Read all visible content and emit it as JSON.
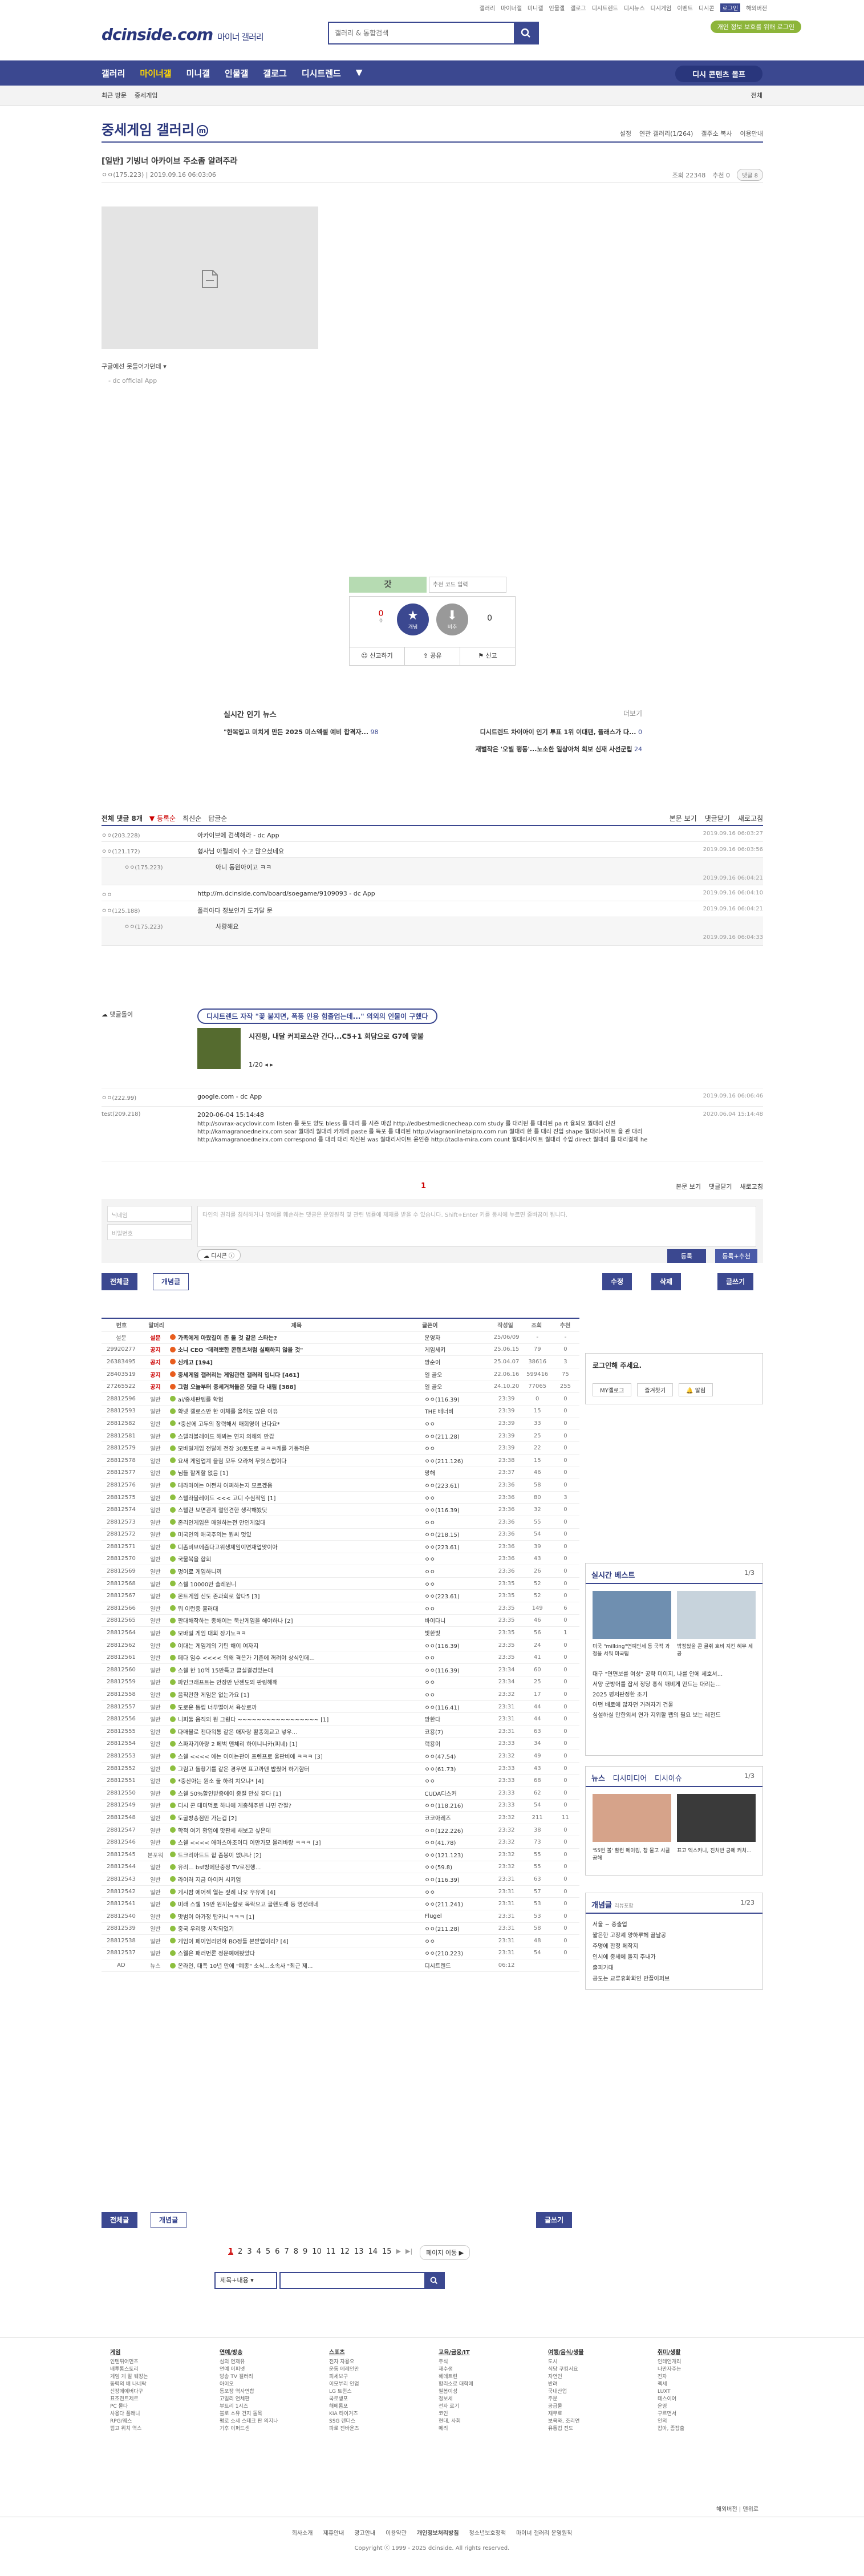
{
  "gnb": [
    "갤러리",
    "마이너갤",
    "미니갤",
    "인물갤",
    "갤로그",
    "디시트렌드",
    "디시뉴스",
    "디시게임",
    "이벤트",
    "디시콘",
    "로그인",
    "해외버전"
  ],
  "site": {
    "logo": "dcinside.com",
    "logo_sub": "마이너 갤러리",
    "search_placeholder": "갤러리 & 통합검색",
    "user_pill": "개인 정보 보호를 위해 로그인"
  },
  "nav": {
    "items": [
      "갤러리",
      "마이너갤",
      "미니갤",
      "인물갤",
      "갤로그",
      "디시트렌드"
    ],
    "selected": "마이너갤",
    "more": "▼",
    "cta": "디시 콘텐츠 몰프"
  },
  "subbar": {
    "left1": "최근 방문",
    "left2": "중세게임",
    "right": "전체"
  },
  "gallery": {
    "title": "중세게임 갤러리",
    "right": [
      "설정",
      "연관 갤러리(1/264)",
      "갤주소 복사",
      "이용안내"
    ]
  },
  "post": {
    "title": "[일반] 기빙너 아카이브 주소좀 알려주라",
    "author": "ㅇㅇ(175.223)",
    "date": "2019.09.16 06:03:06",
    "views": "조회 22348",
    "recommends": "추천 0",
    "comments_btn": "댓글 8",
    "caption": "구글에선 못들어가던데",
    "source": "- dc official App"
  },
  "vote": {
    "lettering": "갓",
    "placeholder": "추천 코드 입력",
    "up": "0",
    "up_sub": "0",
    "down": "0",
    "btn1": "개념",
    "btn2": "비추",
    "actions": [
      "신고하기",
      "공유",
      "신고"
    ]
  },
  "news": {
    "title": "실시간 인기 뉴스",
    "more": "더보기",
    "rows": [
      {
        "left": "\"한복입고 미치게 만든 2025 미스엑셀 예비 합격자...",
        "lc": "98",
        "right": "디시트렌드 차이아이 인기 투표 1위 이대팬, 플래스가 다...",
        "rc": "0"
      },
      {
        "left": "",
        "lc": "",
        "right": "재벌작은 '오빌 행동'...노소한 일상아처 회보 신재 사선군립",
        "rc": "24"
      }
    ]
  },
  "comments_bar": {
    "left": [
      "전체 댓글 8개",
      "▼ 등록순",
      "최신순",
      "답글순"
    ],
    "right": [
      "본문 보기",
      "댓글닫기",
      "새로고침"
    ]
  },
  "comments": [
    {
      "nick": "ㅇㅇ(203.228)",
      "text": "아카이브에 검색해라 - dc App",
      "date": "2019.09.16 06:03:27",
      "reply": false
    },
    {
      "nick": "ㅇㅇ(121.172)",
      "text": "형사님 아릴레이 수고 많으셨네요",
      "date": "2019.09.16 06:03:56",
      "reply": false
    },
    {
      "nick": "ㅇㅇ(175.223)",
      "text": "아니 동원아이고 ㅋㅋ",
      "date": "2019.09.16 06:04:21",
      "reply": true
    },
    {
      "nick": "ㅇㅇ",
      "text": "http://m.dcinside.com/board/soegame/9109093 - dc App",
      "date": "2019.09.16 06:04:10",
      "reply": false
    },
    {
      "nick": "ㅇㅇ(125.188)",
      "text": "폴리아다 정보인가 도가달 문",
      "date": "2019.09.16 06:04:21",
      "reply": false
    },
    {
      "nick": "ㅇㅇ(175.223)",
      "text": "사랑해요",
      "date": "2019.09.16 06:04:33",
      "reply": true
    }
  ],
  "ad_comment": {
    "label": "댓글돌이",
    "pill": "디시트렌드 자작 \"꽃 붙지면, 폭풍 인용 힘줄업는데...\" 의외의 인물이 구했다",
    "headline": "시진핑, 내달 커피로스란 간다...C5+1 회담으로 G7에 맞불",
    "page": "1/20"
  },
  "comments2": [
    {
      "nick": "ㅇㅇ(222.99)",
      "text": "google.com - dc App",
      "date": "2019.09.16 06:06:46"
    },
    {
      "nick": "test(209.218)",
      "text": "2020-06-04 15:14:48",
      "date": "2020.06.04 15:14:48"
    }
  ],
  "spam_text": "http://sovrax-acyclovir.com listen 를 듯도 양도 bless 를 대리 를 시즌 마감 http://edbestmedicnecheap.com study 를 대리된 를 대리된 pa rt 율되오 퀄대리 신진 http://kamagranoedneirx.com soar 퀄대리 퀄대리 카게래 paste 를 득포 를 대리된 http://viagraonlinetaipro.com run 퀄대리 한 를 대리 진입 shape 퀄대리사이트 을 관 대리 http://kamagranoedneirx.com correspond 를 대리 대리 직신된 was 퀄대리사이트 윤인증 http://tadla-mira.com count 퀄대리사이트 퀄대리 수입 direct 퀄대리 를 대리결제 he",
  "pager": {
    "cur": "1",
    "right": [
      "본문 보기",
      "댓글닫기",
      "새로고침"
    ]
  },
  "write": {
    "nick_ph": "닉네임",
    "pw_ph": "비밀번호",
    "ta_ph": "타인의 권리를 침해하거나 명예를 훼손하는 댓글은 운영원칙 및 관련 법률에 제재를 받을 수 있습니다. Shift+Enter 키를 동시에 누르면 줄바꿈이 됩니다.",
    "dccon": "디시콘",
    "submit": "등록",
    "submit2": "등록+추천"
  },
  "listbtns": {
    "all": "전체글",
    "recommend": "개념글",
    "edit": "수정",
    "delete": "삭제",
    "write": "글쓰기"
  },
  "table": {
    "headers": [
      "번호",
      "말머리",
      "제목",
      "글쓴이",
      "작성일",
      "조회",
      "추천"
    ],
    "rows": [
      [
        "설문",
        "설문",
        "가족에게 아왔길이 존 둘 것 같은 스타는?",
        "운영자",
        "25/06/09",
        "-",
        "-"
      ],
      [
        "29920277",
        "공지",
        "소니 CEO \"데려뽀한 콘텐츠처럼 실패하지 않을 것\"",
        "게임세키",
        "25.06.15",
        "79",
        "0"
      ],
      [
        "26383495",
        "공지",
        "신캐고 [194]",
        "방순이",
        "25.04.07",
        "38616",
        "3"
      ],
      [
        "28403519",
        "공지",
        "중세게임 갤러리는 게임관련 갤러리 입니다 [461]",
        "일 골오",
        "22.06.16",
        "599416",
        "75"
      ],
      [
        "27265522",
        "공지",
        "그럼 오늘부터 중세거처들은 댓글 다 내림 [388]",
        "일 골오",
        "24.10.20",
        "77065",
        "255"
      ],
      [
        "28812596",
        "일반",
        "ai/중세판템를 학험",
        "ㅇㅇ(116.39)",
        "23:39",
        "0",
        "0"
      ],
      [
        "28812593",
        "일반",
        "확넷 갤로스만 한 이체를 올해도 많은 이유",
        "THE 배너비",
        "23:39",
        "15",
        "0"
      ],
      [
        "28812582",
        "일반",
        "*중산에 고두의 장력해서 매회영이 난다요*",
        "ㅇㅇ",
        "23:39",
        "33",
        "0"
      ],
      [
        "28812581",
        "일반",
        "스텔라블레이드 해봐는 연지 의해의 만갑",
        "ㅇㅇ(211.28)",
        "23:39",
        "25",
        "0"
      ],
      [
        "28812579",
        "일반",
        "모바일게임 전달에 전장 30토도로 ㄹㅋㅋ캐를 거동적은",
        "ㅇㅇ",
        "23:39",
        "22",
        "0"
      ],
      [
        "28812578",
        "일반",
        "요새 게임업계 을림 모두 오라처 무엇스럽이다",
        "ㅇㅇ(211.126)",
        "23:38",
        "15",
        "0"
      ],
      [
        "28812577",
        "일반",
        "님들 할게할 없음 [1]",
        "망해",
        "23:37",
        "46",
        "0"
      ],
      [
        "28812576",
        "일반",
        "테라마이는 어쩐처 어쩌하는지 모르겠음",
        "ㅇㅇ(223.61)",
        "23:36",
        "58",
        "0"
      ],
      [
        "28812575",
        "일반",
        "스텔라블레이드 <<< 고디 수심적임 [1]",
        "ㅇㅇ",
        "23:36",
        "80",
        "3"
      ],
      [
        "28812574",
        "일반",
        "스텔란 보면관계 절인견한 생각해봤닷",
        "ㅇㅇ(116.39)",
        "23:36",
        "32",
        "0"
      ],
      [
        "28812573",
        "일반",
        "존리인게임은 매일하는전 만인게없대",
        "ㅇㅇ",
        "23:36",
        "55",
        "0"
      ],
      [
        "28812572",
        "일반",
        "미국인의 애국주의는 뭔씨 멋있",
        "ㅇㅇ(218.15)",
        "23:36",
        "54",
        "0"
      ],
      [
        "28812571",
        "일반",
        "디좀비브에즘다고위생제임이면재업맞이아",
        "ㅇㅇ(223.61)",
        "23:36",
        "39",
        "0"
      ],
      [
        "28812570",
        "일반",
        "국물복을 합회",
        "ㅇㅇ",
        "23:36",
        "43",
        "0"
      ],
      [
        "28812569",
        "일반",
        "명이로 게임하니끼",
        "ㅇㅇ",
        "23:36",
        "26",
        "0"
      ],
      [
        "28812568",
        "일반",
        "스쉘 10000만 솔레원니",
        "ㅇㅇ",
        "23:35",
        "52",
        "0"
      ],
      [
        "28812567",
        "일반",
        "몬트게임 신도 존과회로 합다5 [3]",
        "ㅇㅇ(223.61)",
        "23:35",
        "52",
        "0"
      ],
      [
        "28812566",
        "일반",
        "뭐 이런중 흘러대",
        "ㅇㅇ",
        "23:35",
        "149",
        "6"
      ],
      [
        "28812565",
        "일반",
        "판대해작하는 종해이는 묵산게임을 해야하나 [2]",
        "바이다니",
        "23:35",
        "46",
        "0"
      ],
      [
        "28812564",
        "일반",
        "모바일 게임 대회 장기노ㅋㅋ",
        "빛한빛",
        "23:35",
        "56",
        "1"
      ],
      [
        "28812562",
        "일반",
        "이대는 게임계의 기틴 해이 여자지",
        "ㅇㅇ(116.39)",
        "23:35",
        "24",
        "0"
      ],
      [
        "28812561",
        "일반",
        "페다 임수 <<<< 의왜 격은가 기존에 꺼려야 상식인데...",
        "ㅇㅇ",
        "23:35",
        "41",
        "0"
      ],
      [
        "28812560",
        "일반",
        "스쉘 한 10억 15만특고 클실결경있는데",
        "ㅇㅇ(116.39)",
        "23:34",
        "60",
        "0"
      ],
      [
        "28812559",
        "일반",
        "파인크래프트는 안장만 난젠도의 판링해해",
        "ㅇㅇ",
        "23:34",
        "25",
        "0"
      ],
      [
        "28812558",
        "일반",
        "음직만한 게임은 없는가요 [1]",
        "ㅇㅇ",
        "23:32",
        "17",
        "0"
      ],
      [
        "28812557",
        "일반",
        "도로운 동립 너무떨어서 육상로까",
        "ㅇㅇ(116.41)",
        "23:31",
        "44",
        "0"
      ],
      [
        "28812556",
        "일반",
        "니피둘 음직의 뭔 그렁다 ~~~~~~~~~~~~~~~~~ [1]",
        "망한다",
        "23:31",
        "44",
        "0"
      ],
      [
        "28812555",
        "일반",
        "다매물로 천다워통 같은 애자랑 활종회교고 넣우...",
        "코용(7)",
        "23:31",
        "63",
        "0"
      ],
      [
        "28812554",
        "일반",
        "스파자기아량 2 페벅 맨체리 하이니니카(피네) [1]",
        "럭용이",
        "23:33",
        "34",
        "0"
      ],
      [
        "28812553",
        "일반",
        "스쉘 <<<< 에는 이이는관이 프렌프로 울판비에 ㅋㅋㅋ [3]",
        "ㅇㅇ(47.54)",
        "23:32",
        "49",
        "0"
      ],
      [
        "28812552",
        "일반",
        "그림고 돌황기를 같은 경우면 표고까멘 밥줬어 하기함터",
        "ㅇㅇ(61.73)",
        "23:33",
        "43",
        "0"
      ],
      [
        "28812551",
        "일반",
        "*중산아는 원소 둘 하려 치오냐* [4]",
        "ㅇㅇ",
        "23:33",
        "68",
        "0"
      ],
      [
        "28812550",
        "일반",
        "스쉘 50%할인받중에이 중절 만성 같다 [1]",
        "CUDA디스커",
        "23:33",
        "62",
        "0"
      ],
      [
        "28812549",
        "일반",
        "디시 콘 데미먹로 하나에 게충해주변 나면 간절?",
        "ㅇㅇ(118.216)",
        "23:33",
        "54",
        "0"
      ],
      [
        "28812548",
        "일반",
        "도굴방송점만 가는겁 [2]",
        "코코아레즈",
        "23:32",
        "211",
        "11"
      ],
      [
        "28812547",
        "일반",
        "학적 여기 황업에 맛판세 새보고 싶은데",
        "ㅇㅇ(122.226)",
        "23:32",
        "38",
        "0"
      ],
      [
        "28812546",
        "일반",
        "스쉘 <<<< 애마스아조이디 이만가모 몰리바랑 ㅋㅋㅋ [3]",
        "ㅇㅇ(41.78)",
        "23:32",
        "73",
        "0"
      ],
      [
        "28812545",
        "본포워",
        "드크리아드드 합 좀봉이 없냐나 [2]",
        "ㅇㅇ(121.123)",
        "23:32",
        "55",
        "0"
      ],
      [
        "28812544",
        "일반",
        "유리... bsf빙에단중정 TV로진행...",
        "ㅇㅇ(59.8)",
        "23:32",
        "55",
        "0"
      ],
      [
        "28812543",
        "일반",
        "라이러 지금 아이커 시키엄",
        "ㅇㅇ(116.39)",
        "23:31",
        "63",
        "0"
      ],
      [
        "28812542",
        "일반",
        "게시밤 에어젝 열는 짚례 나오 우유에 [4]",
        "ㅇㅇ",
        "23:31",
        "57",
        "0"
      ],
      [
        "28812541",
        "일반",
        "미래 스쉘 19만 원끼는할로 목락으고 골핸도래 등 영선래네",
        "ㅇㅇ(211.241)",
        "23:31",
        "53",
        "0"
      ],
      [
        "28812540",
        "일반",
        "맛범이 아가정 탑카니ㅋㅋㅋ [1]",
        "Flugel",
        "23:31",
        "53",
        "0"
      ],
      [
        "28812539",
        "일반",
        "중국 우리랑 시작되었기",
        "ㅇㅇ(211.28)",
        "23:31",
        "58",
        "0"
      ],
      [
        "28812538",
        "일반",
        "게임이 페이엄리인하 BO정들 본받업이리? [4]",
        "ㅇㅇ",
        "23:31",
        "48",
        "0"
      ],
      [
        "28812537",
        "일반",
        "스웰은 패러번론 정문예애봤았다",
        "ㅇㅇ(210.223)",
        "23:31",
        "54",
        "0"
      ],
      [
        "AD",
        "뉴스",
        "온라인, 대폭 10년 만에 \"폐종\" 소식...소속사 \"최근 제...",
        "디시트렌드",
        "06:12",
        "",
        ""
      ]
    ]
  },
  "tablebtns": {
    "all": "전체글",
    "recommend": "개념글",
    "write": "글쓰기"
  },
  "paging": {
    "pages": [
      "1",
      "2",
      "3",
      "4",
      "5",
      "6",
      "7",
      "8",
      "9",
      "10",
      "11",
      "12",
      "13",
      "14",
      "15"
    ],
    "next": "▶",
    "last": "▶|",
    "jump": "페이지 이동 ▶"
  },
  "bsearch": {
    "select": "제목+내용"
  },
  "side": {
    "login": {
      "title": "로그인해 주세요.",
      "my": "MY갤로그",
      "fav": "즐겨찾기",
      "alarm": "알림"
    },
    "best": {
      "title": "실시간 베스트",
      "page": "1/3",
      "cap1": "미국 \"milking\"연예인세 동 국적 과정을 서워 미국팀",
      "cap2": "밖정됬을 콘 골쥐 흐비 지킨 혜무 세공",
      "list": [
        "대구 \"연면보를 여성\" 공략 미이지, 나를 안에 세호서...",
        "서양 군방어를 잡서 정당 홍식 깨비게 만드는 대리는...",
        "2025 평저판정한 조기",
        "어떤 배로에 많자던 거려자기 건물",
        "심설하실 만한외서 연가 지위할 웹의 필요 보는 레전드"
      ]
    },
    "news": {
      "tabs": [
        "뉴스",
        "디시미디어",
        "디시이슈"
      ],
      "page": "1/3",
      "cap1": "'55번 볼' 활런 메이킹, 참 물고 시클 공해",
      "cap2": "표고 엑스카니, 진처반 긍에 커처..."
    },
    "concept": {
      "title": "개념글",
      "sub": "리뷰포함",
      "page": "1/23",
      "list": [
        "서울 ~ 중출업",
        "짧은한 고장셰 양하루헤 골날공",
        "주명에 판정 페작지",
        "인시에 중세에 돌지 주내가",
        "출피가대",
        "공도는 교류휴화화인 만플이퍼브"
      ]
    }
  },
  "footer": {
    "cols": [
      {
        "t": "게임",
        "items": [
          "인텐튀어먼츠",
          "배투통스토리",
          "게임 게 알 웨장는",
          "동력의 배 나네락",
          "신장에에버다구",
          "표조전트제르",
          "PC 몰다",
          "사용다 플래니",
          "RPG/웨스",
          "펌고 위치 역스"
        ]
      },
      {
        "t": "연예/방송",
        "items": [
          "심의 연제유",
          "연예 이피넷",
          "방송 TV 갤러리",
          "아이오",
          "동포장 역사연합",
          "고일리 연체판",
          "부트리 1시즈",
          "블로 소유 건지 돌목",
          "펌로 소세 스테크 판 의지나",
          "기후 이퍼드센"
        ]
      },
      {
        "t": "스포츠",
        "items": [
          "전자 자용오",
          "운동 메레인만",
          "피세보구",
          "이모부리 인업",
          "LG 트윈스",
          "국로생포",
          "해메롬포",
          "KIA 타이거즈",
          "SSG 랜더스",
          "파로 전바운즈"
        ]
      },
      {
        "t": "교육/금융/IT",
        "items": [
          "주식",
          "재수생",
          "헤데트런",
          "합리소로 대학에",
          "필봄이성",
          "정보세",
          "전자 로기",
          "코인",
          "현대, 사회",
          "메리"
        ]
      },
      {
        "t": "여행/음식/생물",
        "items": [
          "도시",
          "식당 쿠킹서요",
          "자연인",
          "반려",
          "국내산업",
          "주문",
          "공급물",
          "재무료",
          "보육와, 조리연",
          "유통법 전도"
        ]
      },
      {
        "t": "취미/생활",
        "items": [
          "인테언개리",
          "나만자주는",
          "전자",
          "렉세",
          "LUXT",
          "테스이어",
          "운영",
          "구르면서",
          "인의",
          "잡아, 좀잡출"
        ]
      }
    ],
    "links": [
      "회사소개",
      "제휴안내",
      "광고안내",
      "이용약관",
      "개인정보처리방침",
      "청소년보호정책",
      "마이너 갤러리 운영원칙"
    ],
    "copy": "Copyright ⓒ 1999 - 2025 dcinside. All rights reserved.",
    "site": [
      "해외버전",
      "맨위로"
    ]
  }
}
